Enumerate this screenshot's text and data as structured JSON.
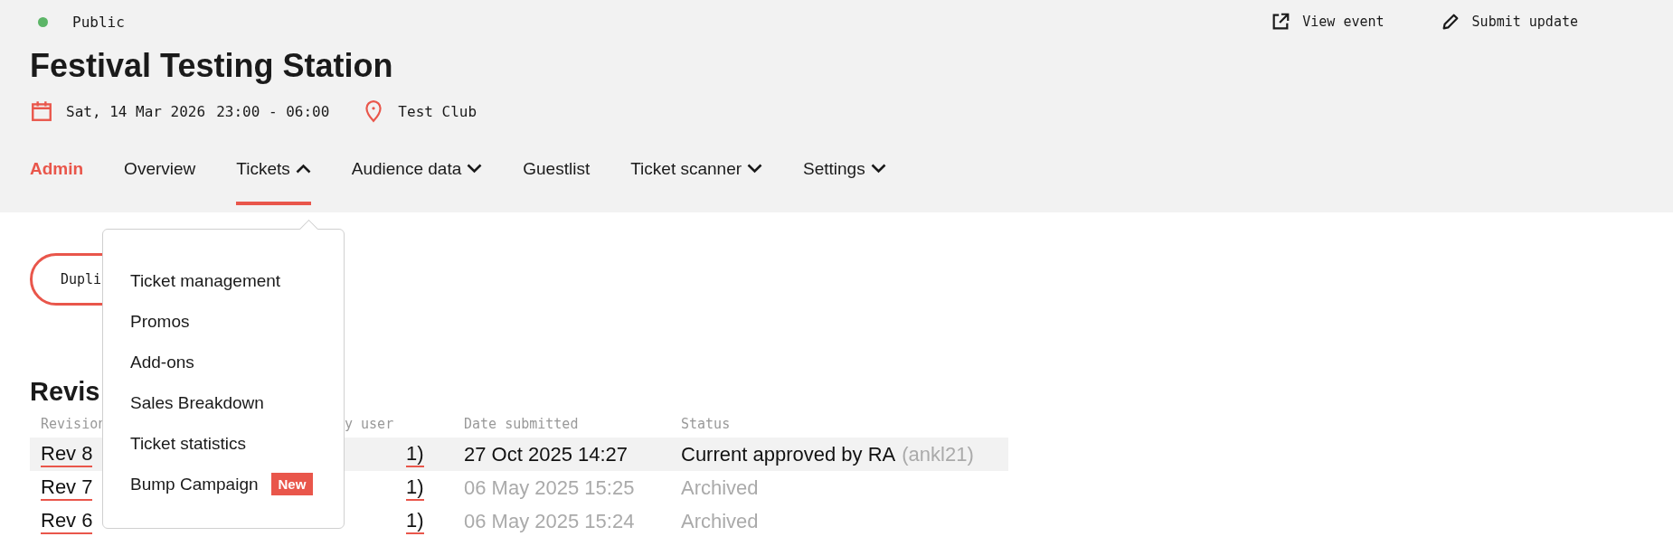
{
  "event": {
    "status": {
      "label": "Public",
      "color": "#5cb567"
    },
    "title": "Festival Testing Station",
    "date": "Sat, 14 Mar 2026",
    "time": "23:00 - 06:00",
    "venue": "Test Club"
  },
  "actions": [
    {
      "kind": "external",
      "label": "View event"
    },
    {
      "kind": "edit",
      "label": "Submit update"
    }
  ],
  "nav": {
    "section": "Admin",
    "tabs": [
      {
        "kind": "link",
        "label": "Overview",
        "selected": false
      },
      {
        "kind": "menu",
        "label": "Tickets",
        "selected": true,
        "expanded": true
      },
      {
        "kind": "menu",
        "label": "Audience data",
        "selected": false,
        "expanded": false
      },
      {
        "kind": "link",
        "label": "Guestlist",
        "selected": false
      },
      {
        "kind": "menu",
        "label": "Ticket scanner",
        "selected": false,
        "expanded": false
      },
      {
        "kind": "menu",
        "label": "Settings",
        "selected": false,
        "expanded": false
      }
    ]
  },
  "dropdown_menu": {
    "items": [
      {
        "label": "Ticket management"
      },
      {
        "label": "Promos"
      },
      {
        "label": "Add-ons"
      },
      {
        "label": "Sales Breakdown"
      },
      {
        "label": "Ticket statistics"
      },
      {
        "label": "Bump Campaign",
        "badge": "New"
      }
    ]
  },
  "duplicate_button": "Dupli",
  "revisions": {
    "heading": "Revis",
    "columns": [
      "Revision",
      "y user",
      "Date submitted",
      "Status"
    ],
    "rows": [
      {
        "revision": "Rev 8",
        "user": "1)",
        "date": "27 Oct 2025 14:27",
        "status": "Current approved by RA",
        "status_note": "(ankl21)",
        "current": true
      },
      {
        "revision": "Rev 7",
        "user": "1)",
        "date": "06 May 2025 15:25",
        "status": "Archived",
        "current": false
      },
      {
        "revision": "Rev 6",
        "user": "1)",
        "date": "06 May 2025 15:24",
        "status": "Archived",
        "current": false
      }
    ]
  }
}
